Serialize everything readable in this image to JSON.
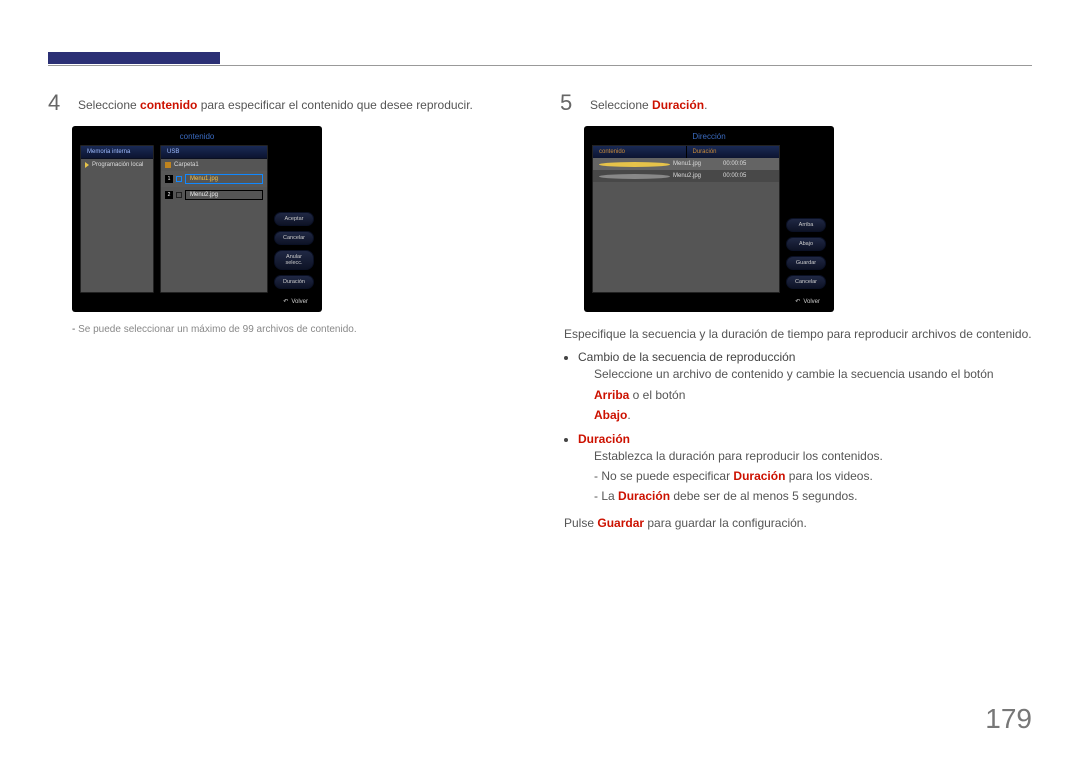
{
  "page_number": "179",
  "left": {
    "step_num": "4",
    "step_text_a": "Seleccione ",
    "step_text_bold": "contenido",
    "step_text_b": " para especificar el contenido que desee reproducir.",
    "screen_title": "contenido",
    "panel_head_left": "Memoria interna",
    "panel_head_mid": "USB",
    "left_item": "Programación local",
    "folder": "Carpeta1",
    "file1_num": "1",
    "file1": "Menu1.jpg",
    "file2_num": "2",
    "file2": "Menu2.jpg",
    "btns": [
      "Aceptar",
      "Cancelar",
      "Anular selecc.",
      "Duración"
    ],
    "volver": "Volver",
    "note": "Se puede seleccionar un máximo de 99 archivos de contenido."
  },
  "right": {
    "step_num": "5",
    "step_text_a": "Seleccione ",
    "step_text_bold": "Duración",
    "step_text_b": ".",
    "screen_title": "Dirección",
    "head_a": "contenido",
    "head_b": "Duración",
    "row1_name": "Menu1.jpg",
    "row1_dur": "00:00:05",
    "row2_name": "Menu2.jpg",
    "row2_dur": "00:00:05",
    "btns": [
      "Arriba",
      "Abajo",
      "Guardar",
      "Cancelar"
    ],
    "volver": "Volver",
    "para1": "Especifique la secuencia y la duración de tiempo para reproducir archivos de contenido.",
    "bul1": "Cambio de la secuencia de reproducción",
    "bul1_sub_a": "Seleccione un archivo de contenido y cambie la secuencia usando el botón ",
    "bul1_sub_bold1": "Arriba",
    "bul1_sub_mid": " o el botón ",
    "bul1_sub_bold2": "Abajo",
    "bul1_sub_end": ".",
    "bul2_bold": "Duración",
    "bul2_sub": "Establezca la duración para reproducir los contenidos.",
    "bul2_d1_a": "No se puede especificar ",
    "bul2_d1_bold": "Duración",
    "bul2_d1_b": " para los videos.",
    "bul2_d2_a": "La ",
    "bul2_d2_bold": "Duración",
    "bul2_d2_b": " debe ser de al menos 5 segundos.",
    "para2_a": "Pulse ",
    "para2_bold": "Guardar",
    "para2_b": " para guardar la configuración."
  }
}
